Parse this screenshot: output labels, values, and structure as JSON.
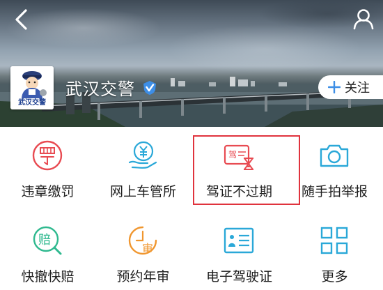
{
  "header": {
    "account_name": "武汉交警",
    "avatar_text": "武汉交警",
    "follow_label": "关注"
  },
  "services": [
    {
      "label": "违章缴罚",
      "icon": "fine-ticket-icon",
      "color": "#e84b52"
    },
    {
      "label": "网上车管所",
      "icon": "yen-hand-icon",
      "color": "#2aa8d8"
    },
    {
      "label": "驾证不过期",
      "icon": "license-hourglass-icon",
      "color": "#e84b52",
      "highlighted": true
    },
    {
      "label": "随手拍举报",
      "icon": "camera-icon",
      "color": "#2aa8d8"
    },
    {
      "label": "快撤快赔",
      "icon": "compensation-magnifier-icon",
      "color": "#2fb98f"
    },
    {
      "label": "预约年审",
      "icon": "annual-inspection-clock-icon",
      "color": "#f0962e"
    },
    {
      "label": "电子驾驶证",
      "icon": "id-card-icon",
      "color": "#2aa8d8"
    },
    {
      "label": "更多",
      "icon": "grid-more-icon",
      "color": "#2aa8d8"
    }
  ],
  "colors": {
    "highlight_border": "#e0333d",
    "verified_badge": "#3d8ee6"
  }
}
